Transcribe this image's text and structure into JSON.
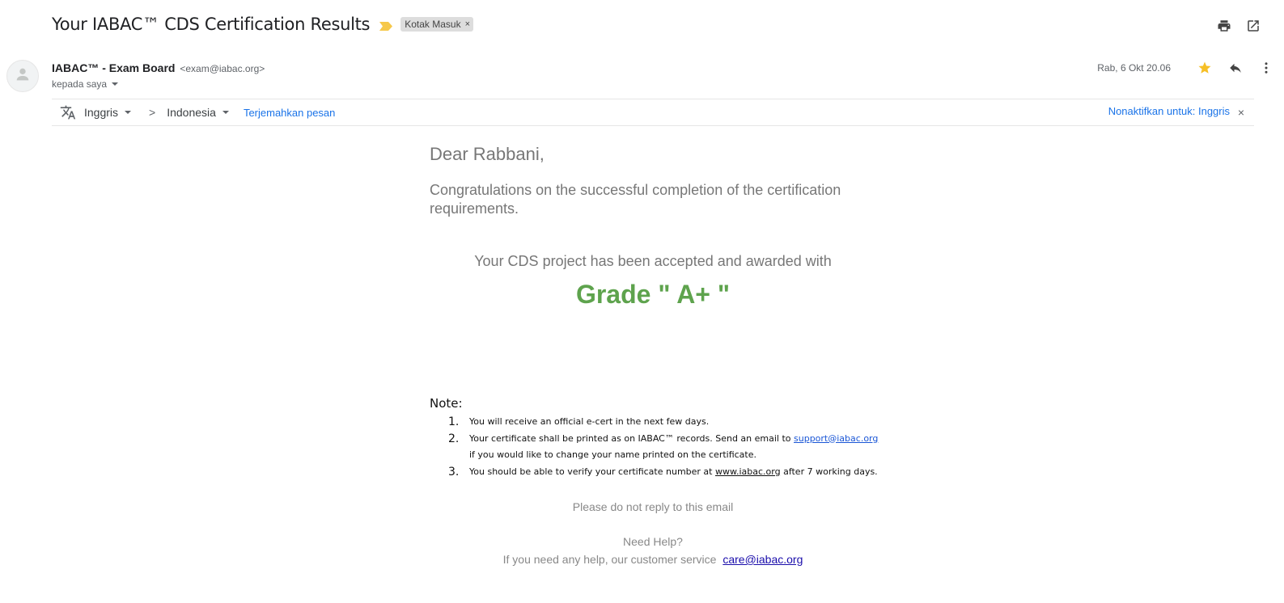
{
  "email": {
    "subject": "Your IABAC™ CDS Certification Results",
    "label_chip": "Kotak Masuk",
    "label_chip_close": "×",
    "sender_name": "IABAC™ - Exam Board",
    "sender_email": "<exam@iabac.org>",
    "recipient": "kepada saya",
    "date": "Rab, 6 Okt 20.06",
    "icons": {
      "print": "print-icon",
      "open_new_window": "open-in-new-window-icon",
      "star": "star-icon",
      "reply": "reply-icon",
      "more": "more-vert-icon",
      "importance": "importance-marker-icon",
      "avatar": "default-avatar-icon",
      "translate": "translate-icon"
    },
    "colors": {
      "star": "#f6bf26",
      "importance": "#f6c84a",
      "grade": "#5ea34d",
      "link": "#1a73e8"
    }
  },
  "translate_bar": {
    "from_lang": "Inggris",
    "to_lang": "Indonesia",
    "chevron": ">",
    "translate_link": "Terjemahkan pesan",
    "disable_link": "Nonaktifkan untuk: Inggris",
    "close": "×"
  },
  "body": {
    "greeting": "Dear Rabbani,",
    "congrats": "Congratulations on the successful completion of the certification requirements.",
    "awarded": "Your CDS project has been accepted and awarded with",
    "grade": "Grade \" A+ \"",
    "note_title": "Note:",
    "notes": [
      {
        "num": "1.",
        "text": "You will receive an official e-cert in the next few days."
      },
      {
        "num": "2.",
        "text_before": "Your certificate shall be printed as on IABAC™ records. Send an email to ",
        "link": "support@iabac.org",
        "text_after": "if you would like to change your name printed on the certificate."
      },
      {
        "num": "3.",
        "text_before": "You should be able to verify your certificate number at ",
        "link": "www.iabac.org",
        "text_after": " after 7 working days."
      }
    ],
    "noreply": "Please do not reply to this email",
    "need_help": "Need Help?",
    "help_text": "If you need any help, our customer service",
    "help_link": "care@iabac.org"
  }
}
